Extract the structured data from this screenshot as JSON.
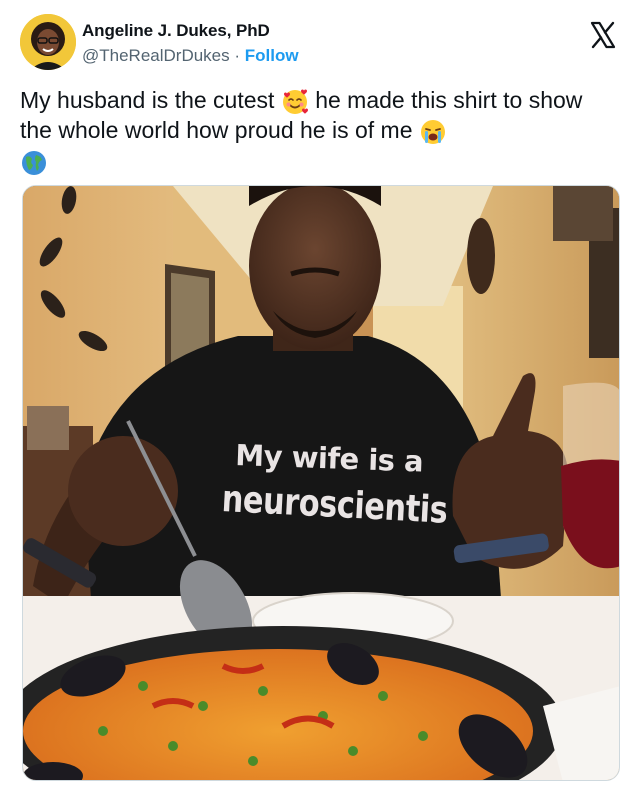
{
  "tweet": {
    "author_name": "Angeline J. Dukes, PhD",
    "handle": "@TheRealDrDukes",
    "separator": "·",
    "follow_label": "Follow",
    "close_icon": "x-logo-icon",
    "text_part1": "My husband is the cutest",
    "text_part2": "he made this shirt to show the whole world how proud he is of me",
    "emojis": [
      "smiling-face-with-hearts-icon",
      "loudly-crying-face-icon",
      "globe-icon"
    ]
  },
  "photo": {
    "shirt_line1": "My wife is a",
    "shirt_line2": "neuroscientis"
  },
  "colors": {
    "link": "#1d9bf0",
    "secondary_text": "#536471",
    "primary_text": "#0f1419"
  }
}
